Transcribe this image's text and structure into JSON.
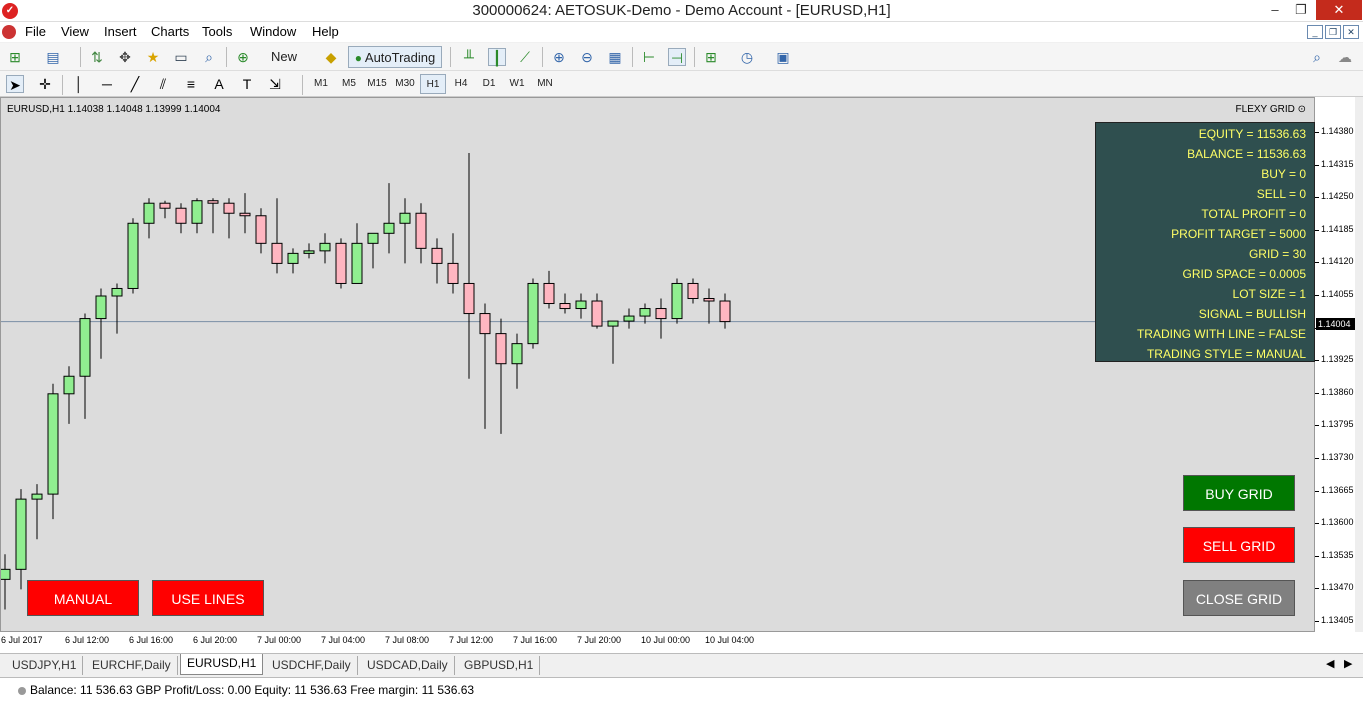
{
  "window": {
    "title": "300000624: AETOSUK-Demo - Demo Account - [EURUSD,H1]",
    "min_icon": "minimize-icon",
    "max_icon": "maximize-icon",
    "close_icon": "close-icon"
  },
  "menu": {
    "items": [
      "File",
      "View",
      "Insert",
      "Charts",
      "Tools",
      "Window",
      "Help"
    ]
  },
  "toolbar": {
    "new_order": "New Order",
    "autotrading": "AutoTrading",
    "timeframes": [
      "M1",
      "M5",
      "M15",
      "M30",
      "H1",
      "H4",
      "D1",
      "W1",
      "MN"
    ],
    "selected_timeframe": "H1"
  },
  "chart": {
    "info": "EURUSD,H1  1.14038 1.14048 1.13999 1.14004",
    "flexy_label": "FLEXY GRID",
    "current_price": "1.14004",
    "y_ticks": [
      "1.14380",
      "1.14315",
      "1.14250",
      "1.14185",
      "1.14120",
      "1.14055",
      "1.13990",
      "1.13925",
      "1.13860",
      "1.13795",
      "1.13730",
      "1.13665",
      "1.13600",
      "1.13535",
      "1.13470",
      "1.13405"
    ],
    "x_ticks": [
      "6 Jul 2017",
      "6 Jul 12:00",
      "6 Jul 16:00",
      "6 Jul 20:00",
      "7 Jul 00:00",
      "7 Jul 04:00",
      "7 Jul 08:00",
      "7 Jul 12:00",
      "7 Jul 16:00",
      "7 Jul 20:00",
      "10 Jul 00:00",
      "10 Jul 04:00"
    ],
    "colors": {
      "bull": "#90ee90",
      "bear": "#ffb6c1",
      "wick": "#000000",
      "background": "#dcdcdc"
    }
  },
  "chart_data": {
    "type": "candlestick",
    "ylim": [
      1.13405,
      1.1438
    ],
    "candles": [
      [
        1.1349,
        1.1354,
        1.1343,
        1.1351
      ],
      [
        1.1351,
        1.1367,
        1.1347,
        1.1365
      ],
      [
        1.1365,
        1.1368,
        1.1357,
        1.1366
      ],
      [
        1.1366,
        1.1388,
        1.1361,
        1.1386
      ],
      [
        1.1386,
        1.13915,
        1.138,
        1.13895
      ],
      [
        1.13895,
        1.1402,
        1.1381,
        1.1401
      ],
      [
        1.1401,
        1.1407,
        1.1393,
        1.14055
      ],
      [
        1.14055,
        1.1408,
        1.1398,
        1.1407
      ],
      [
        1.1407,
        1.1421,
        1.1406,
        1.142
      ],
      [
        1.142,
        1.1425,
        1.1417,
        1.1424
      ],
      [
        1.1424,
        1.14245,
        1.1421,
        1.1423
      ],
      [
        1.1423,
        1.1424,
        1.1418,
        1.142
      ],
      [
        1.142,
        1.1425,
        1.1418,
        1.14245
      ],
      [
        1.14245,
        1.1425,
        1.1418,
        1.1424
      ],
      [
        1.1424,
        1.1425,
        1.1417,
        1.1422
      ],
      [
        1.1422,
        1.1426,
        1.1418,
        1.14215
      ],
      [
        1.14215,
        1.1423,
        1.1414,
        1.1416
      ],
      [
        1.1416,
        1.1425,
        1.141,
        1.1412
      ],
      [
        1.1412,
        1.1415,
        1.141,
        1.1414
      ],
      [
        1.1414,
        1.1416,
        1.1413,
        1.14145
      ],
      [
        1.14145,
        1.1418,
        1.1412,
        1.1416
      ],
      [
        1.1416,
        1.1417,
        1.1407,
        1.1408
      ],
      [
        1.1408,
        1.142,
        1.1408,
        1.1416
      ],
      [
        1.1416,
        1.1418,
        1.1411,
        1.1418
      ],
      [
        1.1418,
        1.1428,
        1.1414,
        1.142
      ],
      [
        1.142,
        1.1425,
        1.1412,
        1.1422
      ],
      [
        1.1422,
        1.1424,
        1.1412,
        1.1415
      ],
      [
        1.1415,
        1.1417,
        1.1408,
        1.1412
      ],
      [
        1.1412,
        1.1418,
        1.1406,
        1.1408
      ],
      [
        1.1408,
        1.1434,
        1.1389,
        1.1402
      ],
      [
        1.1402,
        1.1404,
        1.1379,
        1.1398
      ],
      [
        1.1398,
        1.1401,
        1.1378,
        1.1392
      ],
      [
        1.1392,
        1.1398,
        1.1387,
        1.1396
      ],
      [
        1.1396,
        1.1409,
        1.1395,
        1.1408
      ],
      [
        1.1408,
        1.14105,
        1.1403,
        1.1404
      ],
      [
        1.1404,
        1.1406,
        1.1402,
        1.1403
      ],
      [
        1.1403,
        1.1406,
        1.1401,
        1.14045
      ],
      [
        1.14045,
        1.1406,
        1.1399,
        1.13995
      ],
      [
        1.13995,
        1.14,
        1.1392,
        1.14005
      ],
      [
        1.14005,
        1.1403,
        1.1399,
        1.14015
      ],
      [
        1.14015,
        1.1404,
        1.14,
        1.1403
      ],
      [
        1.1403,
        1.1405,
        1.1397,
        1.1401
      ],
      [
        1.1401,
        1.1409,
        1.14,
        1.1408
      ],
      [
        1.1408,
        1.1409,
        1.1404,
        1.1405
      ],
      [
        1.1405,
        1.1407,
        1.14,
        1.14045
      ],
      [
        1.14045,
        1.1406,
        1.1399,
        1.14004
      ]
    ]
  },
  "info_panel": {
    "lines": [
      "EQUITY = 11536.63",
      "BALANCE = 11536.63",
      "BUY = 0",
      "SELL = 0",
      "TOTAL PROFIT = 0",
      "PROFIT TARGET = 5000",
      "GRID = 30",
      "GRID SPACE = 0.0005",
      "LOT SIZE = 1",
      "SIGNAL = BULLISH",
      "TRADING WITH LINE = FALSE",
      "TRADING STYLE = MANUAL"
    ]
  },
  "buttons": {
    "manual": "MANUAL",
    "use_lines": "USE LINES",
    "buy_grid": "BUY GRID",
    "sell_grid": "SELL GRID",
    "close_grid": "CLOSE GRID",
    "colors": {
      "buy": "#007700",
      "sell": "#ff0000",
      "close": "#808080",
      "manual": "#ff0000"
    }
  },
  "tabs": {
    "items": [
      "USDJPY,H1",
      "EURCHF,Daily",
      "EURUSD,H1",
      "USDCHF,Daily",
      "USDCAD,Daily",
      "GBPUSD,H1"
    ],
    "active": "EURUSD,H1"
  },
  "status": {
    "text": "Balance: 11 536.63 GBP  Profit/Loss: 0.00  Equity: 11 536.63  Free margin: 11 536.63"
  }
}
